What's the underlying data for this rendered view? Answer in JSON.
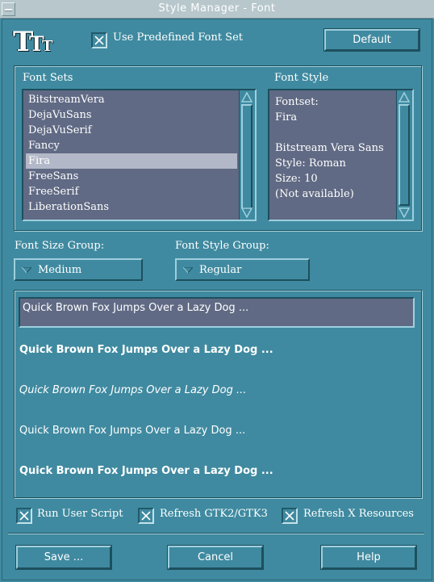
{
  "window": {
    "title": "Style Manager - Font"
  },
  "header": {
    "logo_glyphs": [
      "T",
      "T",
      "T"
    ],
    "use_predefined_label": "Use Predefined Font Set",
    "use_predefined_checked": true,
    "default_button": "Default"
  },
  "font_sets": {
    "label": "Font Sets",
    "items": [
      "BitstreamVera",
      "DejaVuSans",
      "DejaVuSerif",
      "Fancy",
      "Fira",
      "FreeSans",
      "FreeSerif",
      "LiberationSans"
    ],
    "selected_index": 4
  },
  "font_style": {
    "label": "Font Style",
    "lines": [
      "Fontset:",
      "Fira",
      "",
      "Bitstream Vera Sans",
      "Style: Roman",
      "Size: 10",
      "(Not available)"
    ]
  },
  "size_group": {
    "label": "Font Size Group:",
    "value": "Medium"
  },
  "style_group": {
    "label": "Font Style Group:",
    "value": "Regular"
  },
  "preview": {
    "input_text": "Quick Brown Fox Jumps Over a Lazy Dog ...",
    "samples": [
      {
        "text": "Quick Brown Fox Jumps Over a Lazy Dog ...",
        "style": "bold"
      },
      {
        "text": "Quick Brown Fox Jumps Over a Lazy Dog ...",
        "style": "italic"
      },
      {
        "text": "Quick Brown Fox Jumps Over a Lazy Dog ...",
        "style": "regular"
      },
      {
        "text": "Quick Brown Fox Jumps Over a Lazy Dog ...",
        "style": "bold"
      }
    ]
  },
  "options": {
    "run_user_script": {
      "label": "Run User Script",
      "checked": true
    },
    "refresh_gtk": {
      "label": "Refresh GTK2/GTK3",
      "checked": true
    },
    "refresh_x": {
      "label": "Refresh X Resources",
      "checked": true
    }
  },
  "buttons": {
    "save": "Save ...",
    "cancel": "Cancel",
    "help": "Help"
  },
  "colors": {
    "background": "#3f8aa0",
    "list_bg": "#606a84",
    "selection": "#b3b8c8",
    "titlebar": "#b7c7cc"
  }
}
